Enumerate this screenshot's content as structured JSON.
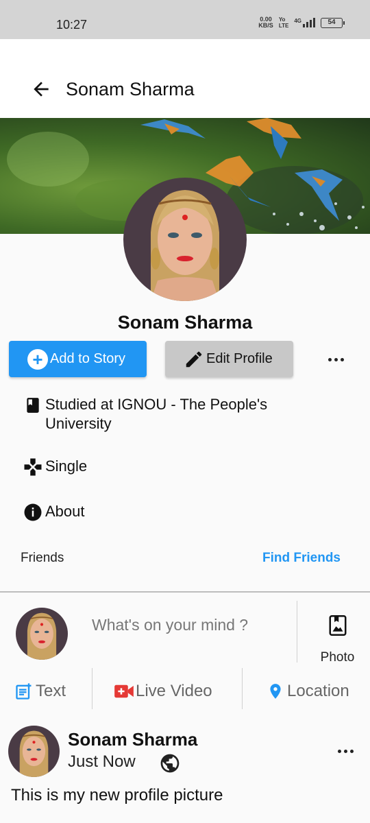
{
  "status_bar": {
    "time": "10:27",
    "net_speed_value": "0.00",
    "net_speed_unit": "KB/S",
    "volte_top": "Yo",
    "volte_bottom": "LTE",
    "network": "4G",
    "battery": "54"
  },
  "app_bar": {
    "title": "Sonam Sharma",
    "back_icon": "arrow-back-icon"
  },
  "profile": {
    "name": "Sonam Sharma",
    "add_story_label": "Add to Story",
    "edit_profile_label": "Edit Profile",
    "more_icon": "more-horizontal-icon"
  },
  "info": {
    "education": "Studied at IGNOU - The People's University",
    "relationship": "Single",
    "about": "About"
  },
  "friends": {
    "label": "Friends",
    "find_label": "Find Friends"
  },
  "composer": {
    "prompt": "What's on your mind ?",
    "photo_label": "Photo",
    "actions": {
      "text": "Text",
      "live_video": "Live Video",
      "location": "Location"
    }
  },
  "post": {
    "author": "Sonam Sharma",
    "time": "Just Now",
    "text": "This is my new profile picture"
  },
  "colors": {
    "accent": "#2196f3",
    "live_video": "#e53935",
    "edit_button": "#c8c8c8"
  }
}
